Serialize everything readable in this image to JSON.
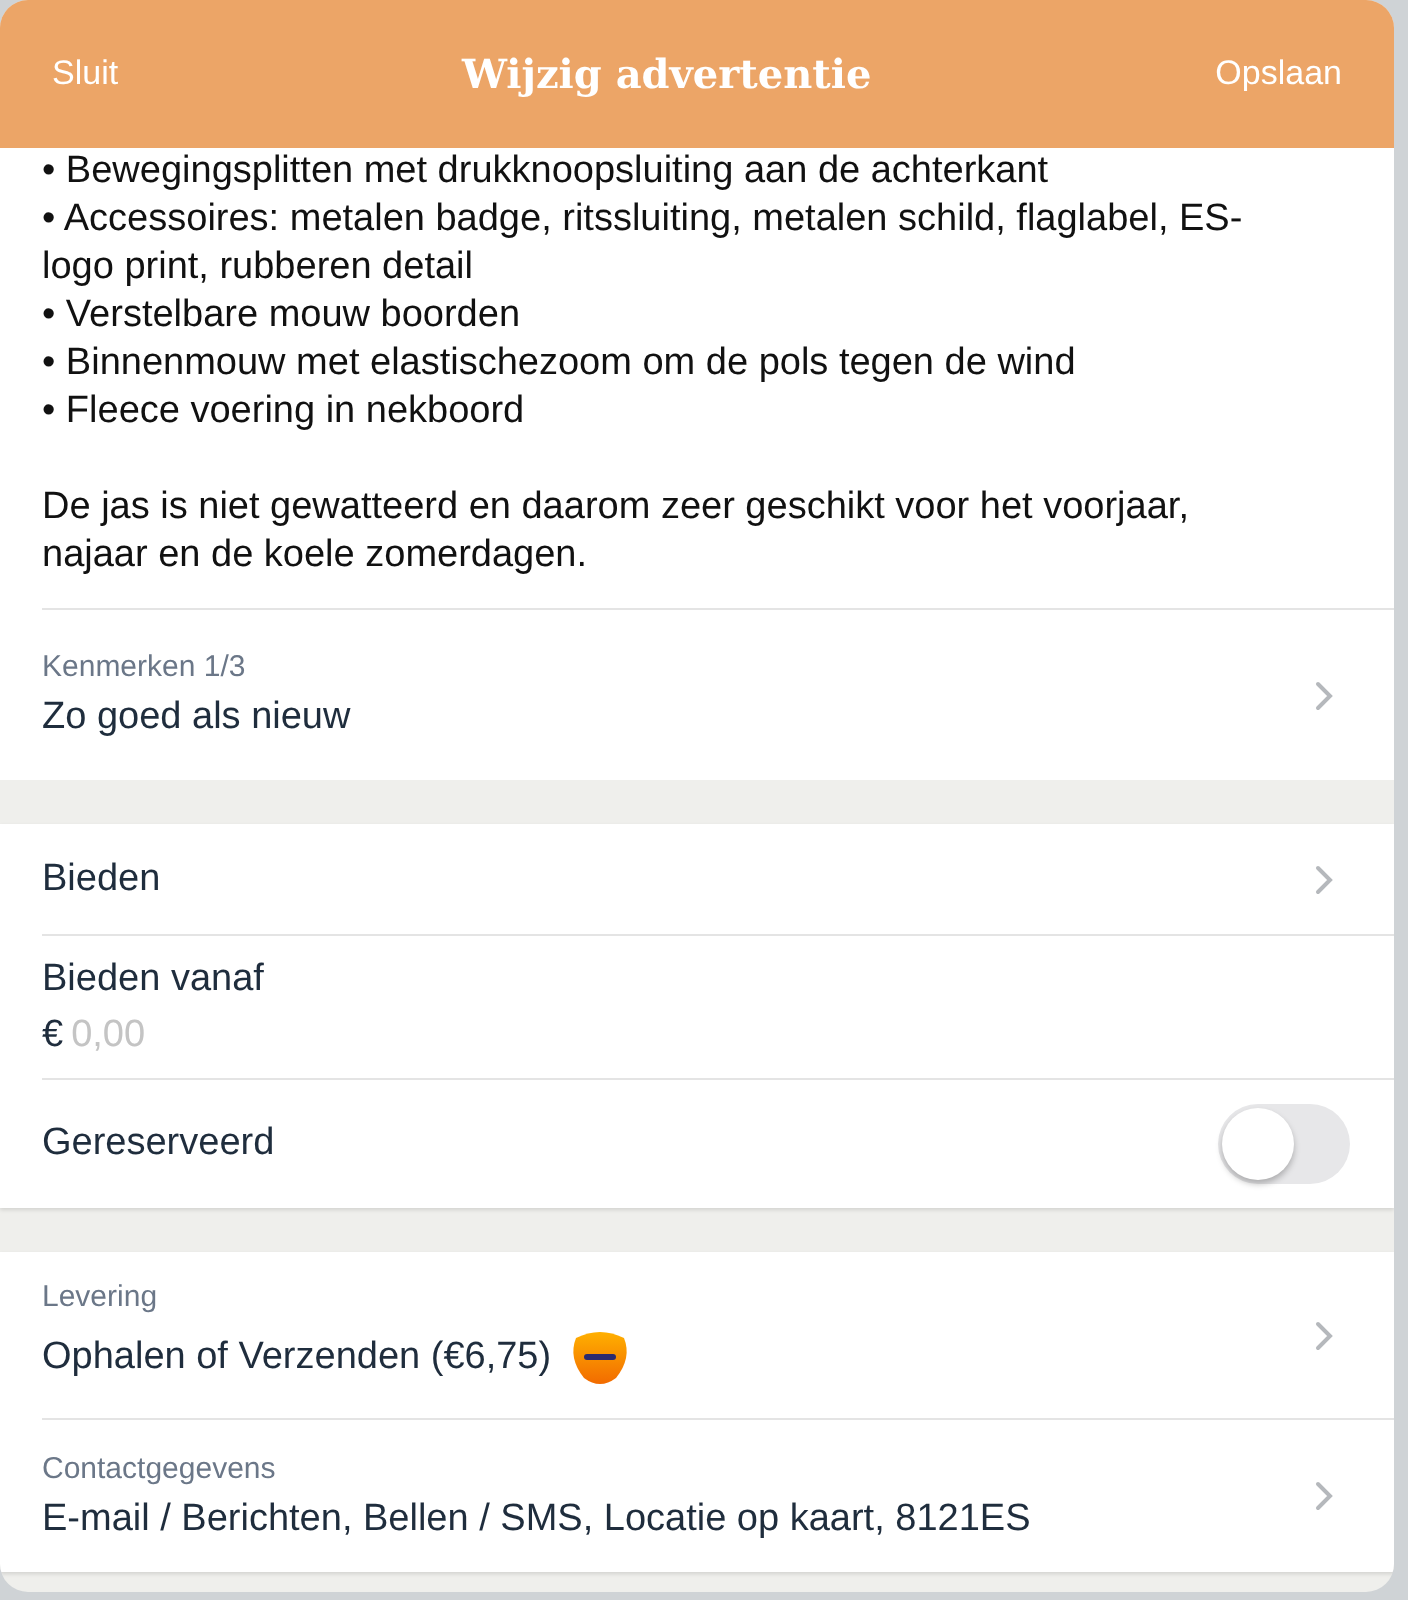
{
  "header": {
    "close": "Sluit",
    "title": "Wijzig advertentie",
    "save": "Opslaan"
  },
  "description": {
    "lines": [
      "• Bewegingsplitten met drukknoopsluiting aan de achterkant",
      "• Accessoires: metalen badge, ritssluiting, metalen schild, flaglabel, ES-logo print, rubberen detail",
      "• Verstelbare mouw boorden",
      "• Binnenmouw met elastischezoom om de pols tegen de wind",
      "• Fleece voering in nekboord"
    ],
    "paragraph": "De jas is niet gewatteerd en daarom zeer geschikt voor het voorjaar, najaar en de koele zomerdagen."
  },
  "attributes": {
    "label": "Kenmerken 1/3",
    "value": "Zo goed als nieuw"
  },
  "bidding": {
    "label": "Bieden",
    "from_label": "Bieden vanaf",
    "currency": "€",
    "placeholder": "0,00",
    "reserved_label": "Gereserveerd",
    "reserved": false
  },
  "delivery": [
    {
      "label": "Levering",
      "value": "Ophalen of Verzenden (€6,75)",
      "logo": true
    },
    {
      "label": "Contactgegevens",
      "value": "E-mail / Berichten, Bellen / SMS, Locatie op kaart, 8121ES",
      "logo": false
    }
  ]
}
